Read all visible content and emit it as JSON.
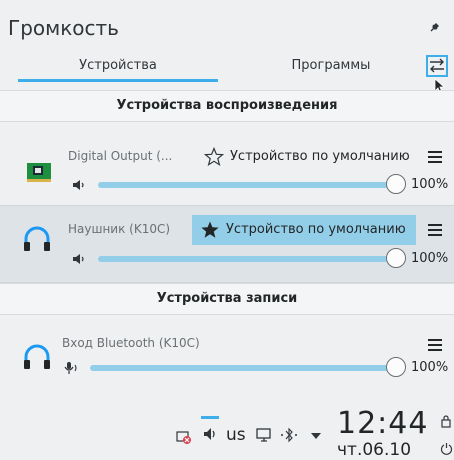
{
  "header": {
    "title": "Громкость"
  },
  "tabs": [
    {
      "label": "Устройства",
      "active": true
    },
    {
      "label": "Программы",
      "active": false
    }
  ],
  "playback": {
    "section_title": "Устройства воспроизведения",
    "devices": [
      {
        "name": "Digital Output (...",
        "icon": "pci-card-icon",
        "default_label": "Устройство по умолчанию",
        "is_default": false,
        "volume_percent": 100,
        "volume_label": "100%"
      },
      {
        "name": "Наушник (K10C)",
        "icon": "headphones-icon",
        "default_label": "Устройство по умолчанию",
        "is_default": true,
        "volume_percent": 100,
        "volume_label": "100%"
      }
    ]
  },
  "recording": {
    "section_title": "Устройства записи",
    "devices": [
      {
        "name": "Вход Bluetooth (K10C)",
        "icon": "headphones-icon",
        "volume_percent": 100,
        "volume_label": "100%"
      }
    ]
  },
  "taskbar": {
    "keyboard_layout": "us",
    "time": "12:44",
    "date": "чт.06.10"
  },
  "colors": {
    "accent": "#3daee9",
    "highlight": "#93cee9",
    "background": "#eff0f1"
  }
}
